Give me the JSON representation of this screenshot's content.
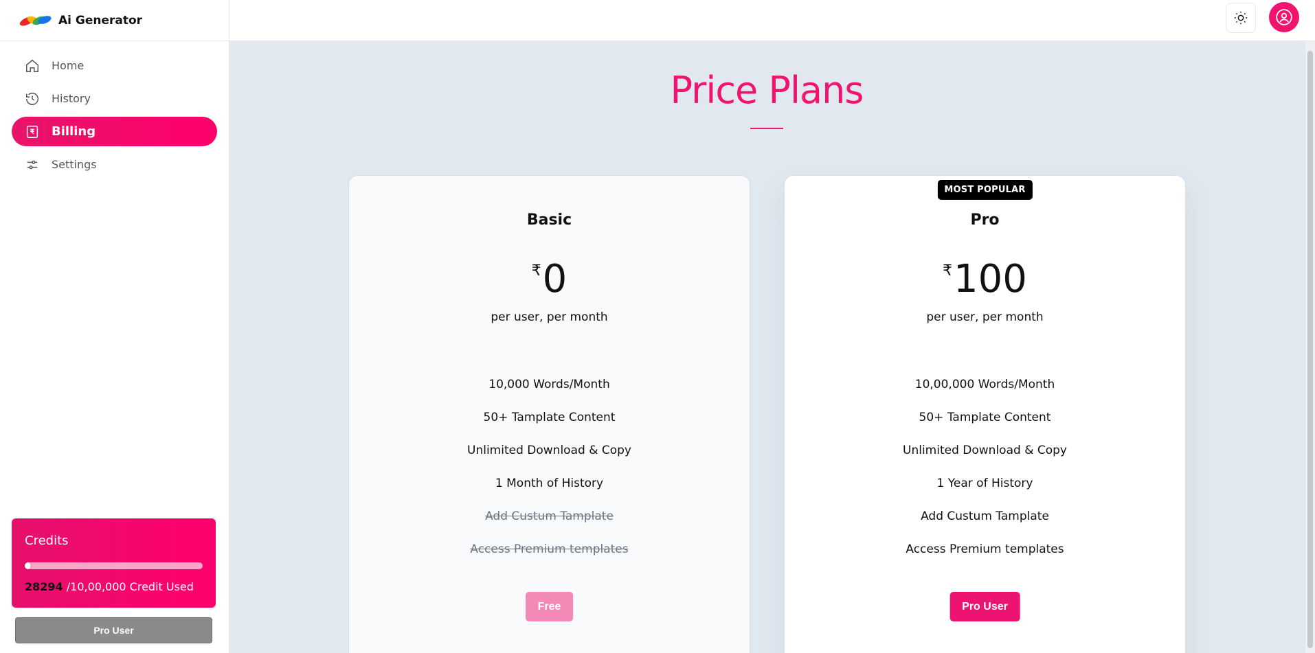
{
  "brand": {
    "name": "Ai Generator"
  },
  "sidebar": {
    "items": [
      {
        "label": "Home",
        "icon": "home-icon",
        "active": false
      },
      {
        "label": "History",
        "icon": "history-icon",
        "active": false
      },
      {
        "label": "Billing",
        "icon": "billing-icon",
        "active": true
      },
      {
        "label": "Settings",
        "icon": "settings-icon",
        "active": false
      }
    ],
    "credits": {
      "title": "Credits",
      "used_value": "28294",
      "used_text": "/10,00,000 Credit Used",
      "progress_fraction": 0.028
    },
    "pro_button": "Pro User"
  },
  "header": {
    "theme_icon": "sun-icon",
    "user_icon": "user-circle-icon"
  },
  "main": {
    "title": "Price Plans",
    "plans": [
      {
        "name": "Basic",
        "currency": "₹",
        "price": "0",
        "period": "per user, per month",
        "badge": "",
        "features": [
          {
            "text": "10,000 Words/Month",
            "included": true
          },
          {
            "text": "50+ Tamplate Content",
            "included": true
          },
          {
            "text": "Unlimited Download & Copy",
            "included": true
          },
          {
            "text": "1 Month of History",
            "included": true
          },
          {
            "text": "Add Custum Tamplate",
            "included": false
          },
          {
            "text": "Access Premium templates",
            "included": false
          }
        ],
        "button": "Free"
      },
      {
        "name": "Pro",
        "currency": "₹",
        "price": "100",
        "period": "per user, per month",
        "badge": "MOST POPULAR",
        "features": [
          {
            "text": "10,00,000 Words/Month",
            "included": true
          },
          {
            "text": "50+ Tamplate Content",
            "included": true
          },
          {
            "text": "Unlimited Download & Copy",
            "included": true
          },
          {
            "text": "1 Year of History",
            "included": true
          },
          {
            "text": "Add Custum Tamplate",
            "included": true
          },
          {
            "text": "Access Premium templates",
            "included": true
          }
        ],
        "button": "Pro User"
      }
    ]
  },
  "colors": {
    "accent": "#f0146e",
    "background": "#e2e8f0"
  }
}
